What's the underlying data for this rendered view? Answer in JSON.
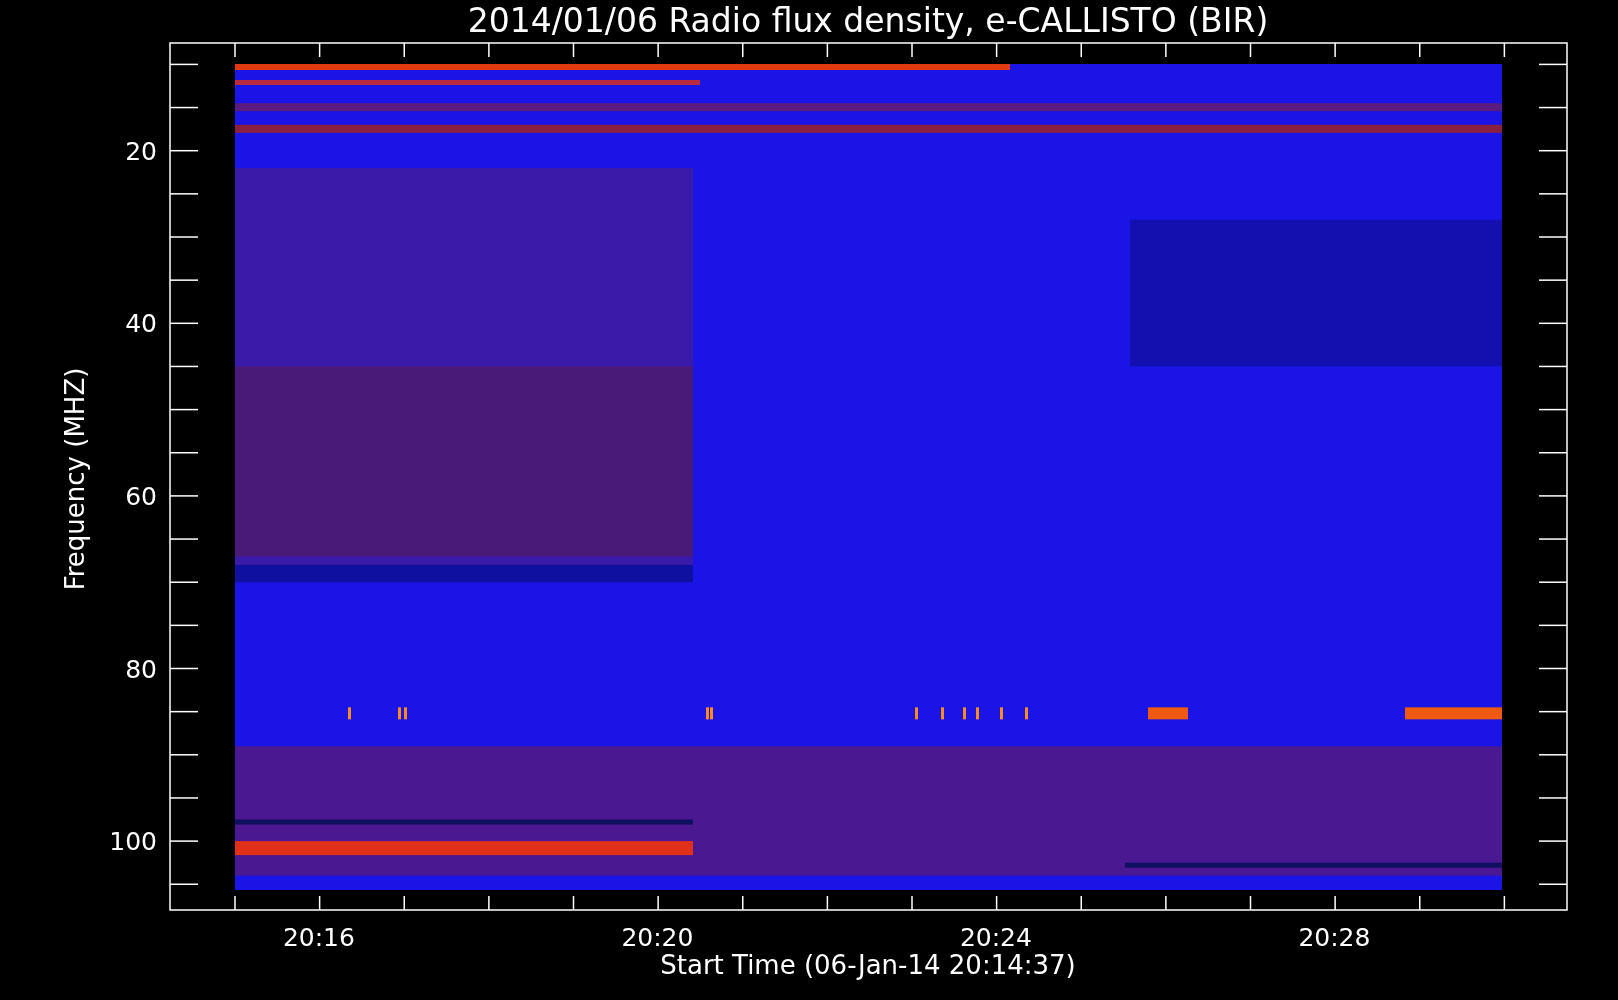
{
  "plot": {
    "title": "2014/01/06  Radio flux density, e-CALLISTO (BIR)",
    "ylabel": "Frequency (MHZ)",
    "xlabel": "Start Time (06-Jan-14 20:14:37)",
    "yticks": [
      "20",
      "40",
      "60",
      "80",
      "100"
    ],
    "xticks": [
      "20:16",
      "20:20",
      "20:24",
      "20:28"
    ]
  }
}
